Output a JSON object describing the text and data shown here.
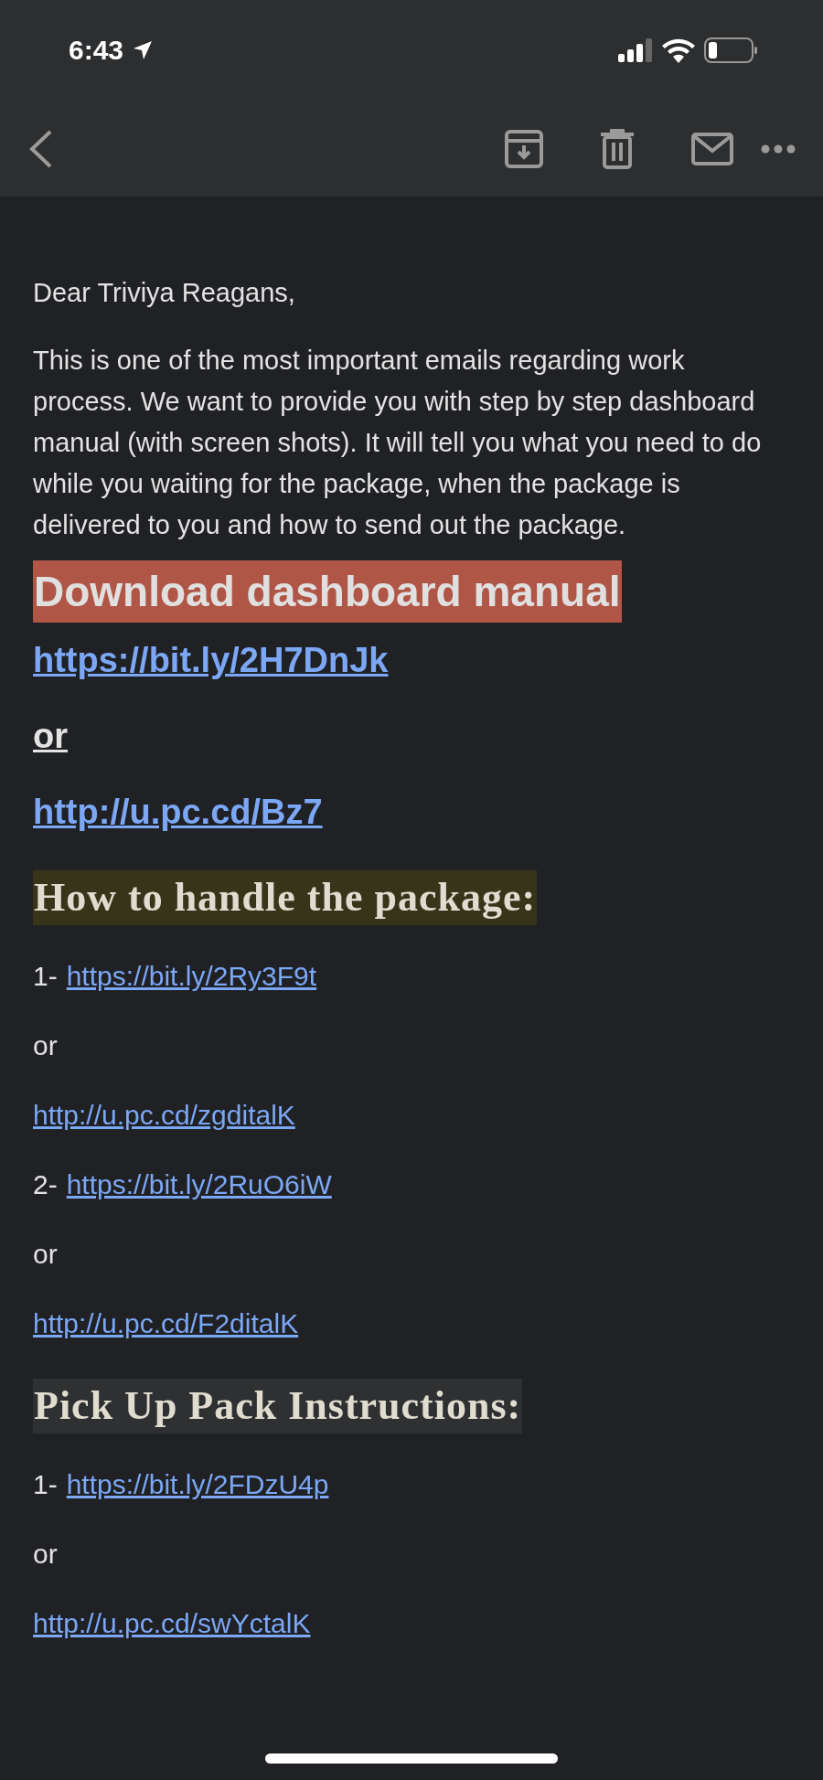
{
  "status_bar": {
    "time": "6:43"
  },
  "email": {
    "greeting": "Dear Triviya Reagans,",
    "paragraph": "This is one of the most important emails regarding work process. We want to provide you with step by step dashboard manual (with screen shots). It will tell you what you need to do while you waiting for the package, when the package is delivered to you and how to send out the package.",
    "blocks": [
      {
        "kind": "banner",
        "text": "Download dashboard manual",
        "color": "#b05646"
      },
      {
        "kind": "big-link",
        "text": "https://bit.ly/2H7DnJk"
      },
      {
        "kind": "big-or",
        "text": "or"
      },
      {
        "kind": "big-link",
        "text": "http://u.pc.cd/Bz7"
      },
      {
        "kind": "serif-heading",
        "text": "How to handle the package:",
        "color": "#38341a"
      },
      {
        "kind": "numbered-link",
        "number": "1-",
        "text": "https://bit.ly/2Ry3F9t"
      },
      {
        "kind": "or",
        "text": "or"
      },
      {
        "kind": "link",
        "text": "http://u.pc.cd/zgditalK"
      },
      {
        "kind": "numbered-link",
        "number": "2-",
        "text": "https://bit.ly/2RuO6iW"
      },
      {
        "kind": "or",
        "text": "or"
      },
      {
        "kind": "link",
        "text": "http://u.pc.cd/F2ditalK"
      },
      {
        "kind": "serif-heading",
        "text": "Pick Up Pack Instructions:",
        "color": "#2f3032"
      },
      {
        "kind": "numbered-link",
        "number": "1-",
        "text": "https://bit.ly/2FDzU4p"
      },
      {
        "kind": "or",
        "text": "or"
      },
      {
        "kind": "link",
        "text": "http://u.pc.cd/swYctalK"
      }
    ]
  }
}
